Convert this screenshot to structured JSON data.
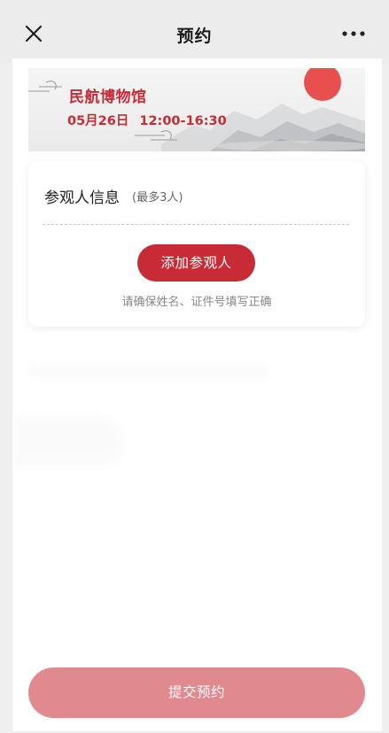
{
  "header": {
    "title": "预约",
    "close_icon": "close-icon",
    "more_icon": "more-dots-icon"
  },
  "banner": {
    "museum_name": "民航博物馆",
    "date": "05月26日",
    "time": "12:00-16:30",
    "sun_color": "#e8504f",
    "accent_color": "#c82b35"
  },
  "visitor_card": {
    "title": "参观人信息",
    "limit_note": "(最多3人)",
    "add_button_label": "添加参观人",
    "hint": "请确保姓名、证件号填写正确"
  },
  "footer": {
    "submit_label": "提交预约",
    "submit_color": "#e08a90"
  }
}
